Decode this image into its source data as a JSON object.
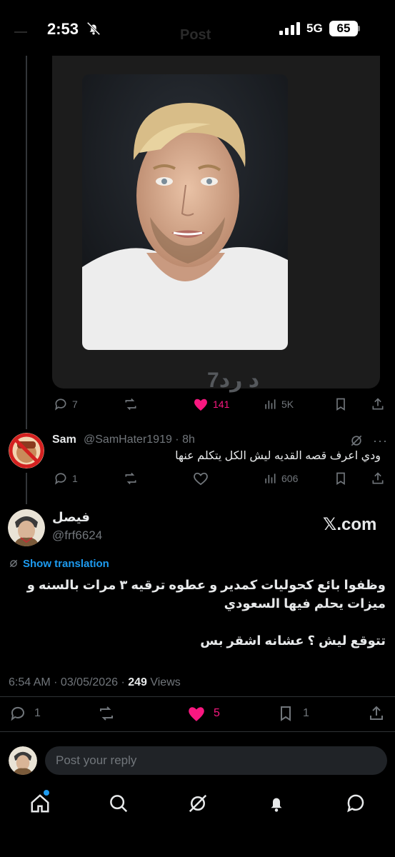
{
  "status_bar": {
    "time": "2:53",
    "network": "5G",
    "battery": "65"
  },
  "header": {
    "title": "Post"
  },
  "quoted_card": {
    "bottom_text": "7د رد"
  },
  "quoted_actions": {
    "replies": "7",
    "reposts": "",
    "likes": "141",
    "views": "5K"
  },
  "reply": {
    "name": "Sam",
    "handle": "@SamHater1919 · 8h",
    "text": "ودي اعرف قصه القديه ليش الكل يتكلم عنها",
    "replies": "1",
    "views": "606"
  },
  "post": {
    "name": "فيصل",
    "handle": "@frf6624",
    "watermark": "𝕏.com",
    "translate_label": "Show translation",
    "text_lines": [
      "وظفوا بائع كحوليات كمدير و عطوه ترقيه ٣ مرات بالسنه و",
      "ميزات يحلم فيها السعودي",
      "",
      "تتوقع ليش ؟ عشانه اشقر بس"
    ],
    "time": "6:54 AM · 03/05/2026 · ",
    "views_count": "249",
    "views_label": " Views",
    "replies": "1",
    "likes": "5",
    "bookmarks": "1"
  },
  "composer": {
    "placeholder": "Post your reply"
  },
  "colors": {
    "like_active": "#f91880",
    "link": "#1d9bf0",
    "muted": "#71767b"
  }
}
